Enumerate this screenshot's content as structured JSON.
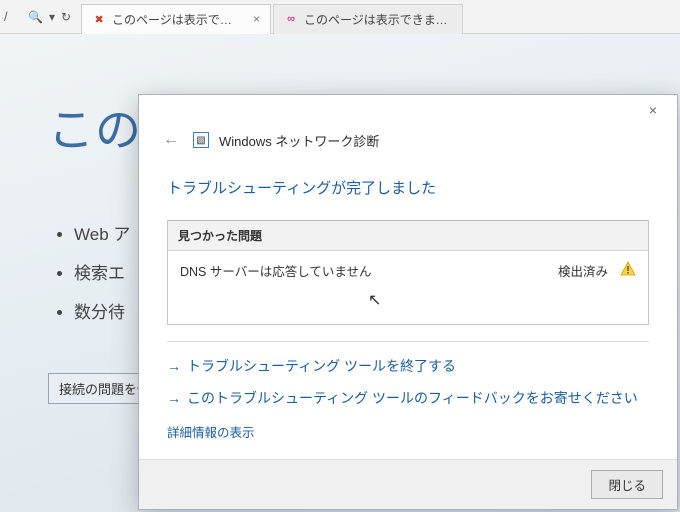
{
  "chrome": {
    "addr_tail": "/",
    "search_glyph": "🔍",
    "refresh_glyph": "↻",
    "sep_glyph": "▾",
    "tabs": [
      {
        "favicon": "✖",
        "label": "このページは表示できません",
        "close": "×"
      },
      {
        "favicon": "∞",
        "label": "このページは表示できません",
        "close": ""
      }
    ]
  },
  "page": {
    "title_visible": "この",
    "bullets": [
      "Web ア",
      "検索エ",
      "数分待"
    ],
    "fix_button": "接続の問題を修"
  },
  "dialog": {
    "close_glyph": "×",
    "back_glyph": "←",
    "icon_glyph": "▧",
    "title": "Windows ネットワーク診断",
    "status": "トラブルシューティングが完了しました",
    "found_header": "見つかった問題",
    "found_item": "DNS サーバーは応答していません",
    "found_status": "検出済み",
    "link_exit": "トラブルシューティング ツールを終了する",
    "link_feedback": "このトラブルシューティング ツールのフィードバックをお寄せください",
    "detail": "詳細情報の表示",
    "close_button": "閉じる",
    "arrow_glyph": "→"
  }
}
